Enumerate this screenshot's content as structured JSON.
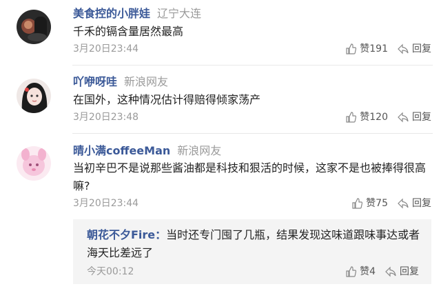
{
  "comments": [
    {
      "username": "美食控的小胖娃",
      "location": "辽宁大连",
      "text": "千禾的镉含量居然最高",
      "time": "3月20日23:44",
      "like_label": "赞191",
      "reply_label": "回复",
      "avatar_icon": "avatar-dark-photo"
    },
    {
      "username": "吖咿呀哇",
      "location": "新浪网友",
      "text": "在国外，这种情况估计得赔得倾家荡产",
      "time": "3月20日23:48",
      "like_label": "赞120",
      "reply_label": "回复",
      "avatar_icon": "avatar-girl-illustration"
    },
    {
      "username": "晴小满coffeeMan",
      "location": "新浪网友",
      "text": "当初辛巴不是说那些酱油都是科技和狠活的时候，这家不是也被捧得很高嘛?",
      "time": "3月20日23:44",
      "like_label": "赞75",
      "reply_label": "回复",
      "avatar_icon": "avatar-pink-character"
    }
  ],
  "reply": {
    "username": "朝花不夕Fire：",
    "text": "当时还专门囤了几瓶，结果发现这味道跟味事达或者海天比差远了",
    "time": "今天00:12",
    "like_label": "赞4",
    "reply_label": "回复"
  },
  "colors": {
    "username": "#3b5998",
    "meta": "#9a9a9a",
    "reply_bg": "#f4f4f4"
  }
}
